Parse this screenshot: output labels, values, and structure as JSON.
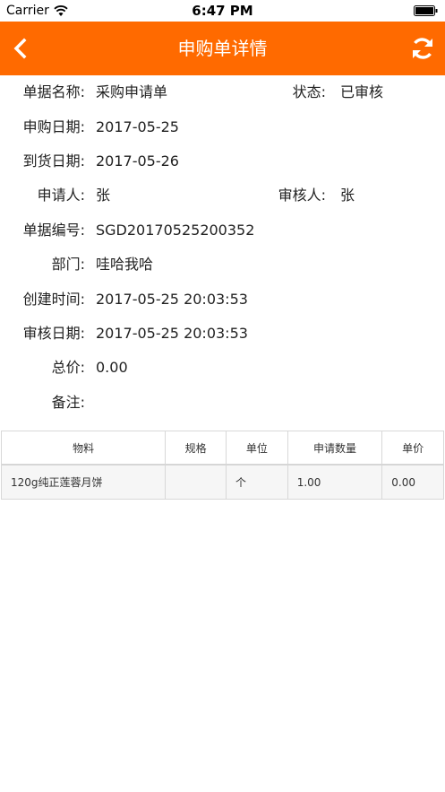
{
  "status_bar": {
    "carrier": "Carrier",
    "time": "6:47 PM"
  },
  "nav": {
    "title": "申购单详情",
    "back_icon": "chevron-left-icon",
    "refresh_icon": "refresh-icon",
    "color": "#ff6a00"
  },
  "detail": {
    "doc_name_label": "单据名称:",
    "doc_name": "采购申请单",
    "status_label": "状态:",
    "status": "已审核",
    "apply_date_label": "申购日期:",
    "apply_date": "2017-05-25",
    "arrival_date_label": "到货日期:",
    "arrival_date": "2017-05-26",
    "applicant_label": "申请人:",
    "applicant": "张",
    "reviewer_label": "审核人:",
    "reviewer": "张",
    "doc_no_label": "单据编号:",
    "doc_no": "SGD20170525200352",
    "dept_label": "部门:",
    "dept": "哇哈我哈",
    "created_label": "创建时间:",
    "created": "2017-05-25 20:03:53",
    "review_date_label": "审核日期:",
    "review_date": "2017-05-25 20:03:53",
    "total_label": "总价:",
    "total": "0.00",
    "remark_label": "备注:",
    "remark": ""
  },
  "table": {
    "headers": [
      "物料",
      "规格",
      "单位",
      "申请数量",
      "单价"
    ],
    "rows": [
      [
        "120g纯正莲蓉月饼",
        "",
        "个",
        "1.00",
        "0.00"
      ]
    ]
  }
}
